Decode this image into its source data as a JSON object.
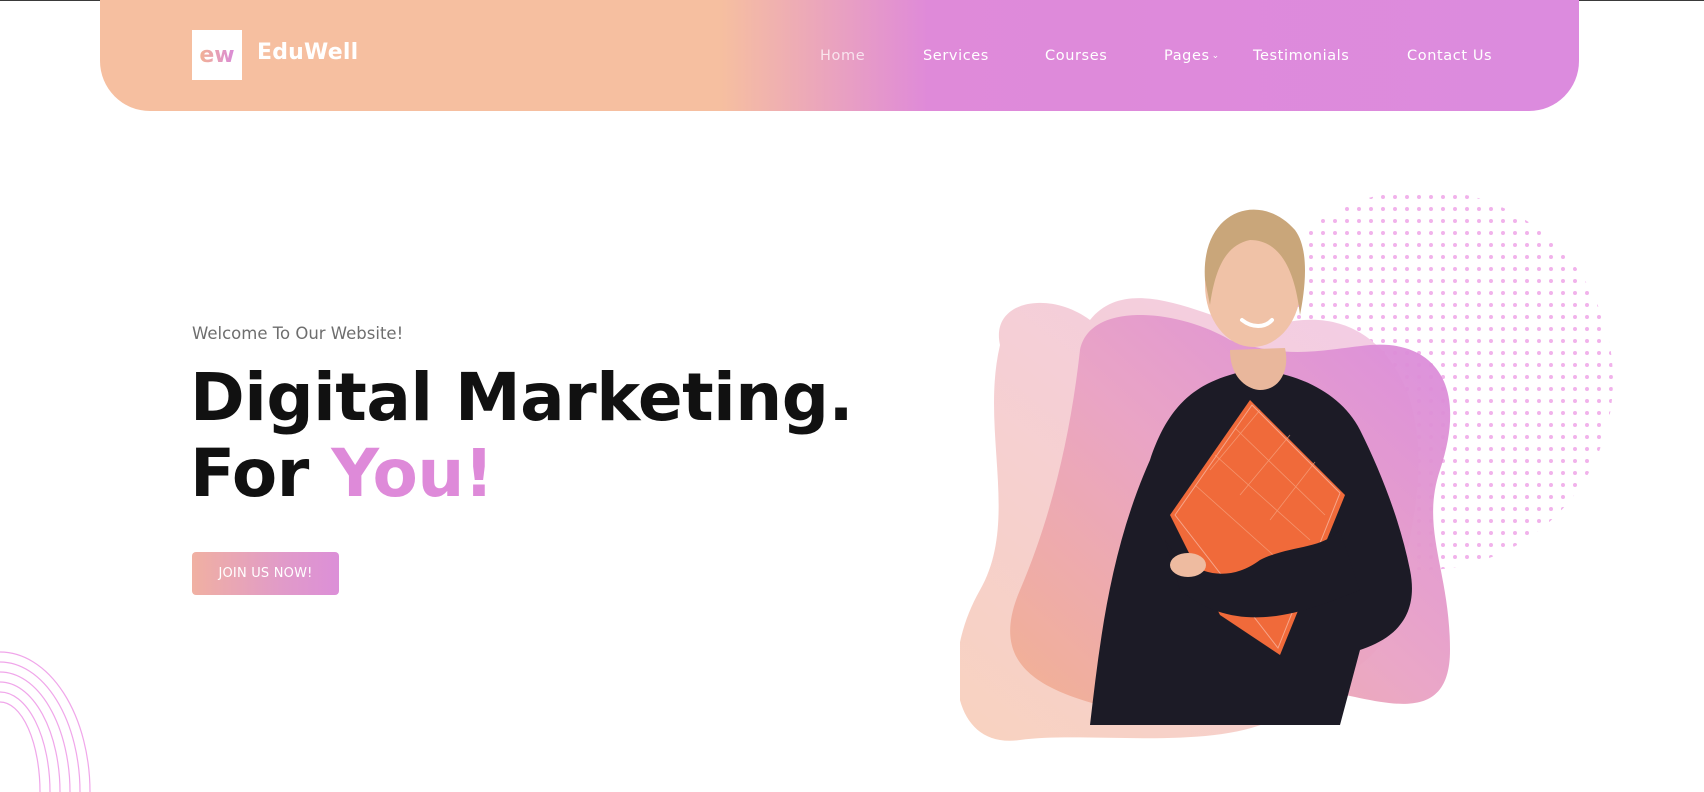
{
  "brand": {
    "logo_text": "ew",
    "name": "EduWell"
  },
  "nav": {
    "items": [
      {
        "label": "Home",
        "active": true
      },
      {
        "label": "Services"
      },
      {
        "label": "Courses"
      },
      {
        "label": "Pages",
        "has_dropdown": true
      },
      {
        "label": "Testimonials"
      },
      {
        "label": "Contact Us"
      }
    ],
    "dropdown_icon": "chevron-down-icon"
  },
  "hero": {
    "welcome": "Welcome To Our Website!",
    "headline_line1": "Digital Marketing.",
    "headline_line2_prefix": "For ",
    "headline_line2_accent": "You!",
    "cta_label": "JOIN US NOW!"
  },
  "colors": {
    "header_start": "#f6bfa0",
    "header_end": "#dc8bde",
    "accent": "#de8ad9",
    "headline": "#111111",
    "welcome": "#6e6e6e"
  }
}
